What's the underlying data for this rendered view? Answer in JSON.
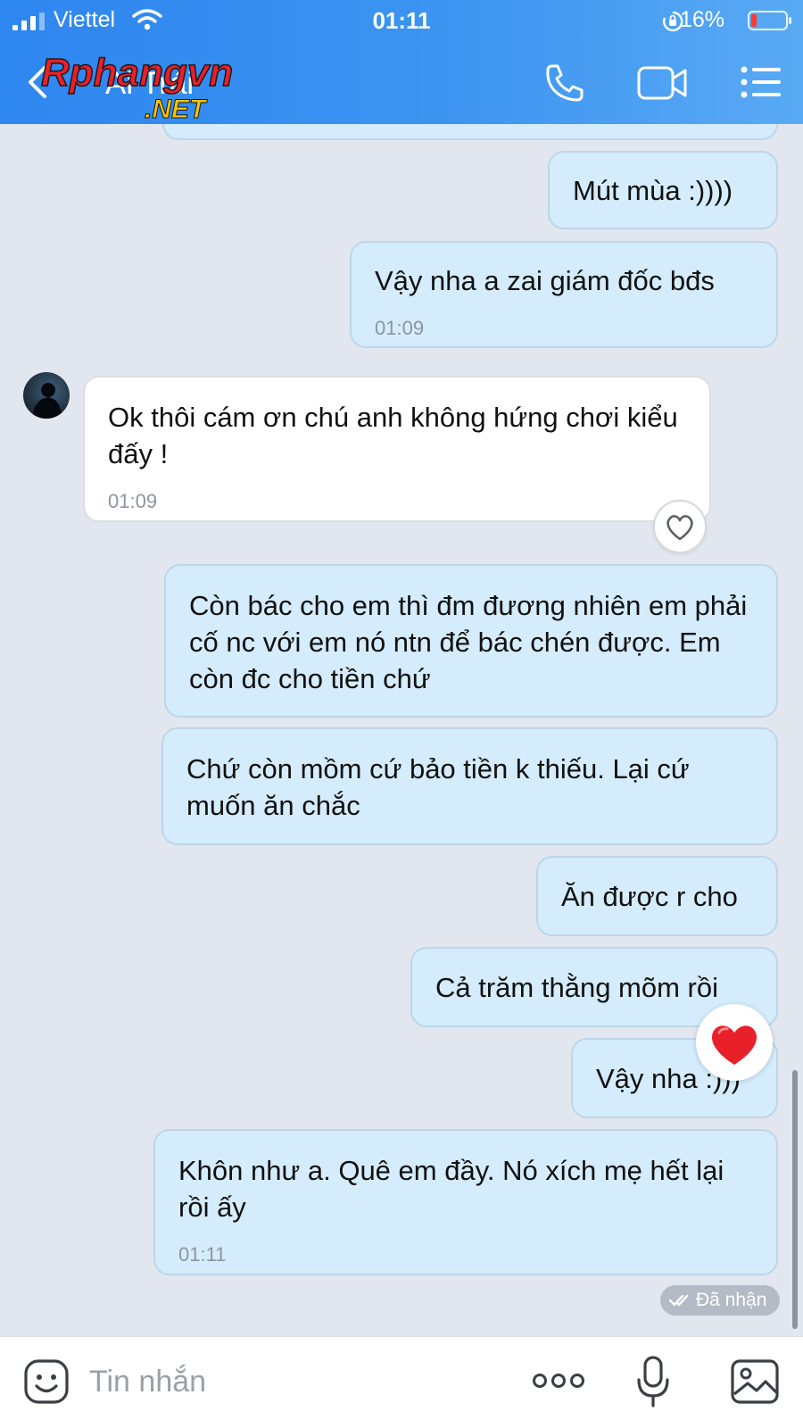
{
  "status_bar": {
    "carrier": "Viettel",
    "time": "01:11",
    "battery_percent": "16%"
  },
  "header": {
    "contact_name": "Ai Trái",
    "watermark_text": "Rphangvn",
    "watermark_suffix": ".NET"
  },
  "messages": [
    {
      "side": "sent",
      "text": "Mút mùa :))))",
      "time": ""
    },
    {
      "side": "sent",
      "text": "Vậy nha a zai giám đốc bđs",
      "time": "01:09"
    },
    {
      "side": "received",
      "text": "Ok thôi cám ơn chú anh không hứng chơi kiểu đấy !",
      "time": "01:09"
    },
    {
      "side": "sent",
      "text": "Còn bác cho em thì đm đương nhiên em phải cố nc với em nó ntn để bác chén được. Em còn đc cho tiền chứ",
      "time": ""
    },
    {
      "side": "sent",
      "text": "Chứ còn mồm cứ bảo tiền k thiếu. Lại cứ muốn ăn chắc",
      "time": ""
    },
    {
      "side": "sent",
      "text": "Ăn được r cho",
      "time": ""
    },
    {
      "side": "sent",
      "text": "Cả trăm thằng mõm rồi",
      "time": ""
    },
    {
      "side": "sent",
      "text": "Vậy nha :)))",
      "time": ""
    },
    {
      "side": "sent",
      "text": "Khôn như a. Quê em đầy. Nó xích mẹ hết lại rồi ấy",
      "time": "01:11"
    }
  ],
  "received_status": "Đã nhận",
  "input": {
    "placeholder": "Tin nhắn"
  },
  "colors": {
    "header_start": "#2e86f0",
    "header_end": "#59aaf4",
    "sent_bubble": "#d4ecfb",
    "received_bubble": "#ffffff",
    "chat_background": "#e2e6ee",
    "reaction_heart": "#e8202a"
  },
  "icons": [
    "signal-icon",
    "wifi-icon",
    "lock-rotation-icon",
    "battery-icon",
    "back-icon",
    "phone-call-icon",
    "video-call-icon",
    "menu-icon",
    "heart-outline-icon",
    "heart-reaction-icon",
    "double-check-icon",
    "emoji-icon",
    "more-icon",
    "mic-icon",
    "image-icon"
  ]
}
